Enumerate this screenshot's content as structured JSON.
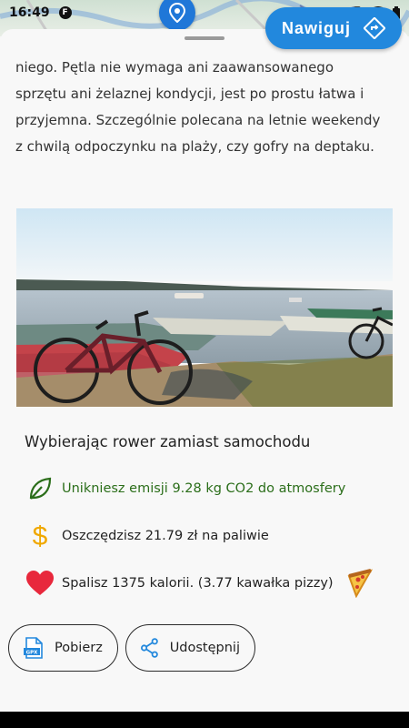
{
  "status_bar": {
    "time": "16:49",
    "app_badge": "F"
  },
  "sheet": {
    "navigate_label": "Nawiguj",
    "description_lines": [
      "niego. Pętla nie wymaga ani zaawansowanego",
      "sprzętu ani żelaznej kondycji, jest po prostu łatwa i",
      "przyjemna. Szczególnie polecana na letnie weekendy",
      "z chwilą odpoczynku na plaży, czy gofry na deptaku."
    ]
  },
  "benefits": {
    "title": "Wybierając rower zamiast samochodu",
    "co2": "Unikniesz emisji 9.28 kg CO2 do atmosfery",
    "money": "Oszczędzisz 21.79 zł na paliwie",
    "calories": "Spalisz 1375 kalorii. (3.77 kawałka pizzy)"
  },
  "actions": {
    "download": "Pobierz",
    "download_icon_text": "GPX",
    "share": "Udostępnij"
  },
  "colors": {
    "accent": "#2288dd",
    "co2_green": "#2b6e1a",
    "money_gold": "#f0a800",
    "heart_red": "#e8283c"
  },
  "icons": [
    "leaf-icon",
    "dollar-icon",
    "heart-icon",
    "pizza-icon",
    "gpx-file-icon",
    "share-icon",
    "directions-icon",
    "map-pin-icon"
  ]
}
